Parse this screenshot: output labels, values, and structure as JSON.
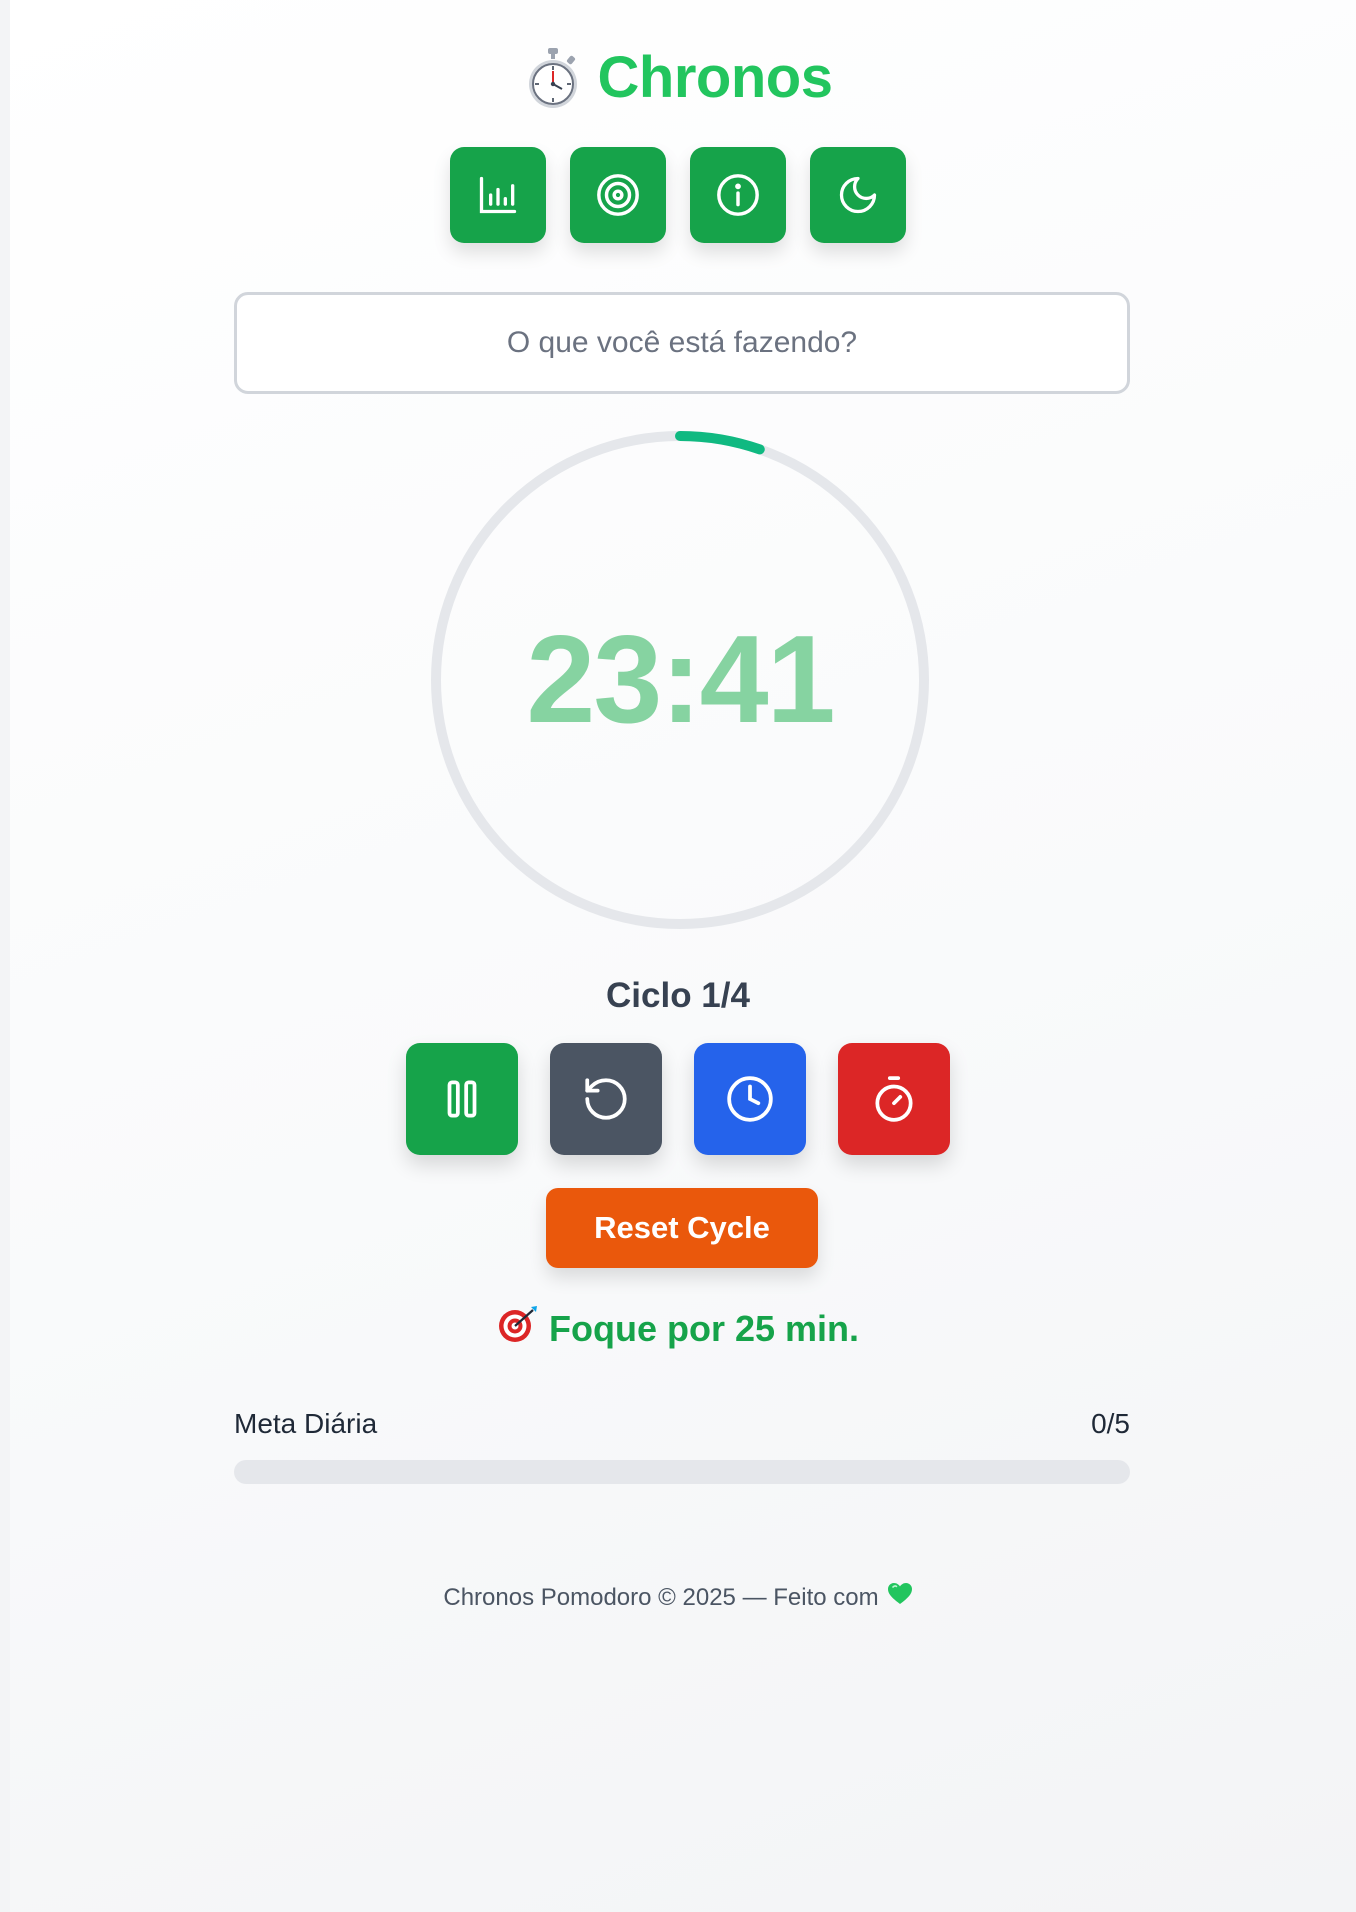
{
  "header": {
    "title": "Chronos",
    "logo_icon": "stopwatch-icon"
  },
  "toolbar": {
    "buttons": [
      {
        "icon": "bar-chart-icon",
        "label": "Stats"
      },
      {
        "icon": "target-icon",
        "label": "Goal"
      },
      {
        "icon": "info-icon",
        "label": "Info"
      },
      {
        "icon": "moon-icon",
        "label": "Dark mode"
      }
    ]
  },
  "task": {
    "value": "",
    "placeholder": "O que você está fazendo?"
  },
  "timer": {
    "display": "23:41",
    "progress": 0.053,
    "progress_color": "#10b981",
    "track_color": "#e5e7eb"
  },
  "cycle": {
    "label": "Ciclo 1/4"
  },
  "controls": [
    {
      "icon": "pause-icon",
      "color": "#16a34a"
    },
    {
      "icon": "reset-icon",
      "color": "#4b5563"
    },
    {
      "icon": "clock-icon",
      "color": "#2563eb"
    },
    {
      "icon": "timer-icon",
      "color": "#dc2626"
    }
  ],
  "reset_cycle": {
    "label": "Reset Cycle",
    "color": "#ea580c"
  },
  "focus": {
    "emoji_icon": "dart-target-icon",
    "message": "Foque por 25 min."
  },
  "daily_goal": {
    "label": "Meta Diária",
    "count": "0/5",
    "progress": 0
  },
  "footer": {
    "text": "Chronos Pomodoro © 2025 — Feito com",
    "heart_icon": "green-heart-icon"
  }
}
